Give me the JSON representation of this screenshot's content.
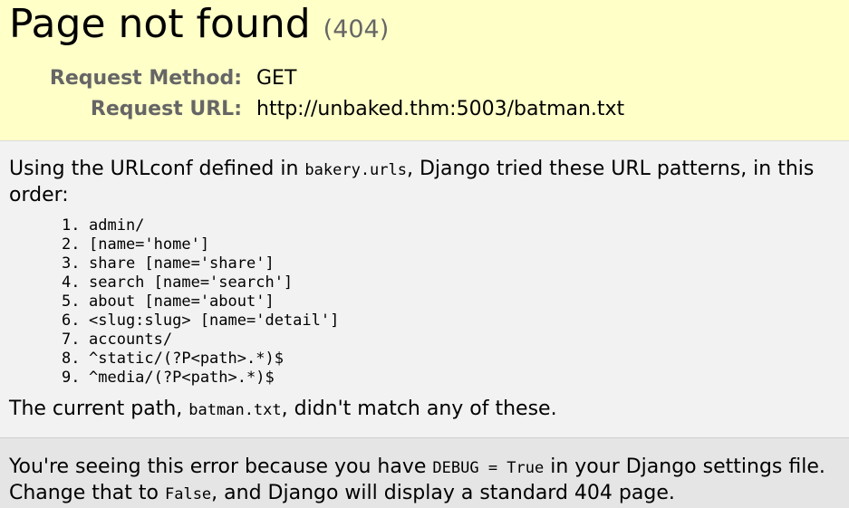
{
  "summary": {
    "title": "Page not found",
    "code": "(404)",
    "request_method_label": "Request Method:",
    "request_method_value": "GET",
    "request_url_label": "Request URL:",
    "request_url_value": "http://unbaked.thm:5003/batman.txt"
  },
  "info": {
    "intro_pre": "Using the URLconf defined in ",
    "urlconf": "bakery.urls",
    "intro_post": ", Django tried these URL patterns, in this order:",
    "patterns": [
      {
        "num": "1.",
        "text": "admin/"
      },
      {
        "num": "2.",
        "text": "[name='home']"
      },
      {
        "num": "3.",
        "text": "share [name='share']"
      },
      {
        "num": "4.",
        "text": "search [name='search']"
      },
      {
        "num": "5.",
        "text": "about [name='about']"
      },
      {
        "num": "6.",
        "text": "<slug:slug> [name='detail']"
      },
      {
        "num": "7.",
        "text": "accounts/"
      },
      {
        "num": "8.",
        "text": "^static/(?P<path>.*)$"
      },
      {
        "num": "9.",
        "text": "^media/(?P<path>.*)$"
      }
    ],
    "current_pre": "The current path, ",
    "current_path": "batman.txt",
    "current_post": ", didn't match any of these."
  },
  "explanation": {
    "line1_pre": "You're seeing this error because you have ",
    "debug_code": "DEBUG = True",
    "line1_post": " in your Django settings file.",
    "line2_pre": "Change that to ",
    "false_code": "False",
    "line2_post": ", and Django will display a standard 404 page."
  }
}
